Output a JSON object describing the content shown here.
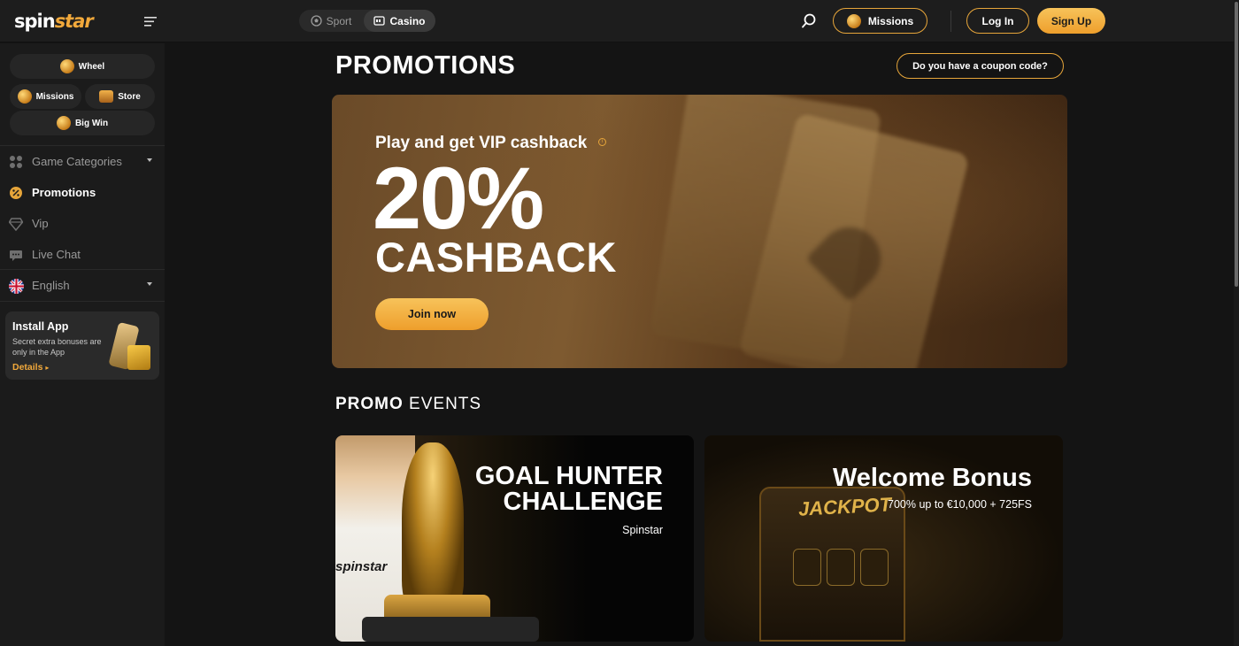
{
  "header": {
    "logo_text_a": "spin",
    "logo_text_b": "star",
    "mode_sport": "Sport",
    "mode_casino": "Casino",
    "missions_label": "Missions",
    "login_label": "Log In",
    "signup_label": "Sign Up"
  },
  "sidebar": {
    "pills": {
      "wheel": "Wheel",
      "missions": "Missions",
      "store": "Store",
      "bigwin": "Big Win"
    },
    "nav": [
      {
        "label": "Game Categories",
        "icon": "grid-icon"
      },
      {
        "label": "Promotions",
        "icon": "promo-badge-icon"
      },
      {
        "label": "Vip",
        "icon": "diamond-icon"
      },
      {
        "label": "Live Chat",
        "icon": "chat-icon"
      },
      {
        "label": "English",
        "icon": "uk-flag-icon"
      }
    ],
    "install": {
      "title": "Install App",
      "desc": "Secret extra bonuses are only in the App",
      "link": "Details"
    }
  },
  "main": {
    "title": "PROMOTIONS",
    "coupon_label": "Do you have a coupon code?",
    "hero": {
      "subtitle": "Play and get VIP cashback",
      "big": "20%",
      "word": "CASHBACK",
      "button": "Join now"
    },
    "section": {
      "bold": "PROMO",
      "rest": " EVENTS"
    },
    "events": [
      {
        "title_line1": "GOAL HUNTER",
        "title_line2": "CHALLENGE",
        "sub": "Spinstar",
        "jersey": "spinstar"
      },
      {
        "title": "Welcome Bonus",
        "sub": "700% up to €10,000 + 725FS",
        "machine_text": "JACKPOT"
      }
    ]
  },
  "colors": {
    "accent": "#f2a93b",
    "background": "#141414",
    "sidebar": "#1b1b1b"
  }
}
